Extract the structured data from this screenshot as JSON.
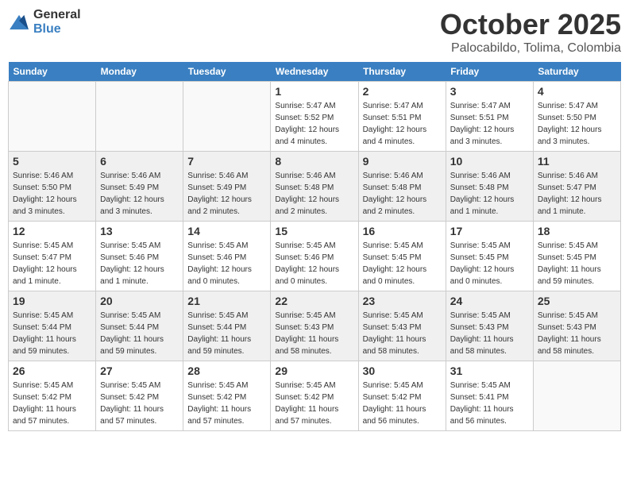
{
  "header": {
    "logo_general": "General",
    "logo_blue": "Blue",
    "month": "October 2025",
    "location": "Palocabildo, Tolima, Colombia"
  },
  "days_of_week": [
    "Sunday",
    "Monday",
    "Tuesday",
    "Wednesday",
    "Thursday",
    "Friday",
    "Saturday"
  ],
  "weeks": [
    [
      {
        "day": "",
        "info": ""
      },
      {
        "day": "",
        "info": ""
      },
      {
        "day": "",
        "info": ""
      },
      {
        "day": "1",
        "info": "Sunrise: 5:47 AM\nSunset: 5:52 PM\nDaylight: 12 hours\nand 4 minutes."
      },
      {
        "day": "2",
        "info": "Sunrise: 5:47 AM\nSunset: 5:51 PM\nDaylight: 12 hours\nand 4 minutes."
      },
      {
        "day": "3",
        "info": "Sunrise: 5:47 AM\nSunset: 5:51 PM\nDaylight: 12 hours\nand 3 minutes."
      },
      {
        "day": "4",
        "info": "Sunrise: 5:47 AM\nSunset: 5:50 PM\nDaylight: 12 hours\nand 3 minutes."
      }
    ],
    [
      {
        "day": "5",
        "info": "Sunrise: 5:46 AM\nSunset: 5:50 PM\nDaylight: 12 hours\nand 3 minutes."
      },
      {
        "day": "6",
        "info": "Sunrise: 5:46 AM\nSunset: 5:49 PM\nDaylight: 12 hours\nand 3 minutes."
      },
      {
        "day": "7",
        "info": "Sunrise: 5:46 AM\nSunset: 5:49 PM\nDaylight: 12 hours\nand 2 minutes."
      },
      {
        "day": "8",
        "info": "Sunrise: 5:46 AM\nSunset: 5:48 PM\nDaylight: 12 hours\nand 2 minutes."
      },
      {
        "day": "9",
        "info": "Sunrise: 5:46 AM\nSunset: 5:48 PM\nDaylight: 12 hours\nand 2 minutes."
      },
      {
        "day": "10",
        "info": "Sunrise: 5:46 AM\nSunset: 5:48 PM\nDaylight: 12 hours\nand 1 minute."
      },
      {
        "day": "11",
        "info": "Sunrise: 5:46 AM\nSunset: 5:47 PM\nDaylight: 12 hours\nand 1 minute."
      }
    ],
    [
      {
        "day": "12",
        "info": "Sunrise: 5:45 AM\nSunset: 5:47 PM\nDaylight: 12 hours\nand 1 minute."
      },
      {
        "day": "13",
        "info": "Sunrise: 5:45 AM\nSunset: 5:46 PM\nDaylight: 12 hours\nand 1 minute."
      },
      {
        "day": "14",
        "info": "Sunrise: 5:45 AM\nSunset: 5:46 PM\nDaylight: 12 hours\nand 0 minutes."
      },
      {
        "day": "15",
        "info": "Sunrise: 5:45 AM\nSunset: 5:46 PM\nDaylight: 12 hours\nand 0 minutes."
      },
      {
        "day": "16",
        "info": "Sunrise: 5:45 AM\nSunset: 5:45 PM\nDaylight: 12 hours\nand 0 minutes."
      },
      {
        "day": "17",
        "info": "Sunrise: 5:45 AM\nSunset: 5:45 PM\nDaylight: 12 hours\nand 0 minutes."
      },
      {
        "day": "18",
        "info": "Sunrise: 5:45 AM\nSunset: 5:45 PM\nDaylight: 11 hours\nand 59 minutes."
      }
    ],
    [
      {
        "day": "19",
        "info": "Sunrise: 5:45 AM\nSunset: 5:44 PM\nDaylight: 11 hours\nand 59 minutes."
      },
      {
        "day": "20",
        "info": "Sunrise: 5:45 AM\nSunset: 5:44 PM\nDaylight: 11 hours\nand 59 minutes."
      },
      {
        "day": "21",
        "info": "Sunrise: 5:45 AM\nSunset: 5:44 PM\nDaylight: 11 hours\nand 59 minutes."
      },
      {
        "day": "22",
        "info": "Sunrise: 5:45 AM\nSunset: 5:43 PM\nDaylight: 11 hours\nand 58 minutes."
      },
      {
        "day": "23",
        "info": "Sunrise: 5:45 AM\nSunset: 5:43 PM\nDaylight: 11 hours\nand 58 minutes."
      },
      {
        "day": "24",
        "info": "Sunrise: 5:45 AM\nSunset: 5:43 PM\nDaylight: 11 hours\nand 58 minutes."
      },
      {
        "day": "25",
        "info": "Sunrise: 5:45 AM\nSunset: 5:43 PM\nDaylight: 11 hours\nand 58 minutes."
      }
    ],
    [
      {
        "day": "26",
        "info": "Sunrise: 5:45 AM\nSunset: 5:42 PM\nDaylight: 11 hours\nand 57 minutes."
      },
      {
        "day": "27",
        "info": "Sunrise: 5:45 AM\nSunset: 5:42 PM\nDaylight: 11 hours\nand 57 minutes."
      },
      {
        "day": "28",
        "info": "Sunrise: 5:45 AM\nSunset: 5:42 PM\nDaylight: 11 hours\nand 57 minutes."
      },
      {
        "day": "29",
        "info": "Sunrise: 5:45 AM\nSunset: 5:42 PM\nDaylight: 11 hours\nand 57 minutes."
      },
      {
        "day": "30",
        "info": "Sunrise: 5:45 AM\nSunset: 5:42 PM\nDaylight: 11 hours\nand 56 minutes."
      },
      {
        "day": "31",
        "info": "Sunrise: 5:45 AM\nSunset: 5:41 PM\nDaylight: 11 hours\nand 56 minutes."
      },
      {
        "day": "",
        "info": ""
      }
    ]
  ]
}
